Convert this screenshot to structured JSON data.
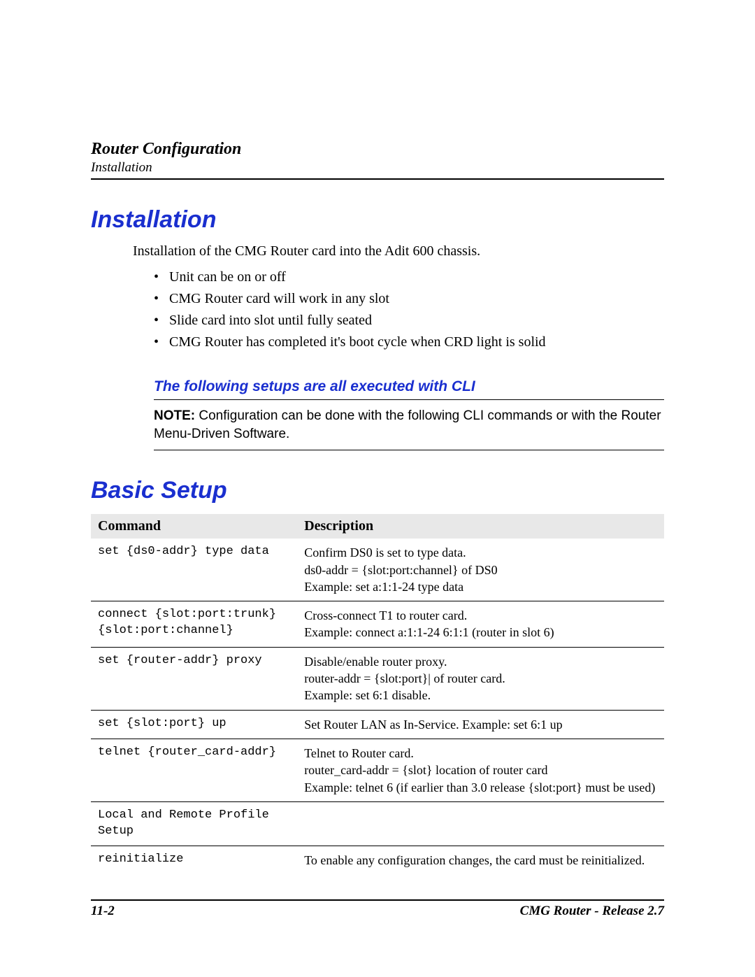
{
  "header": {
    "title": "Router Configuration",
    "subtitle": "Installation"
  },
  "sections": {
    "installation": {
      "heading": "Installation",
      "intro": "Installation of the CMG Router card into the Adit 600 chassis.",
      "bullets": [
        "Unit can be on or off",
        "CMG Router card will work in any slot",
        "Slide card into slot until fully seated",
        "CMG Router has completed it's boot cycle when CRD light is solid"
      ],
      "subheading": "The following setups are all executed with CLI",
      "note_label": "NOTE:",
      "note_text": "Configuration can be done with the following CLI commands or with the Router Menu-Driven Software."
    },
    "basic_setup": {
      "heading": "Basic Setup",
      "columns": {
        "command": "Command",
        "description": "Description"
      },
      "rows": [
        {
          "command": "set {ds0-addr} type data",
          "description": "Confirm DS0 is set to type data.\nds0-addr = {slot:port:channel} of DS0\nExample: set a:1:1-24 type data"
        },
        {
          "command": "connect {slot:port:trunk} {slot:port:channel}",
          "description": "Cross-connect T1 to router card.\nExample: connect a:1:1-24 6:1:1 (router in slot 6)"
        },
        {
          "command": "set {router-addr} proxy",
          "description": "Disable/enable router proxy.\nrouter-addr = {slot:port}| of router card.\nExample: set 6:1 disable."
        },
        {
          "command": "set {slot:port} up",
          "description": "Set Router LAN as In-Service.    Example: set 6:1 up"
        },
        {
          "command": "telnet {router_card-addr}",
          "description": "Telnet to Router card.\nrouter_card-addr = {slot} location of router card\nExample: telnet 6 (if earlier than 3.0 release {slot:port} must be used)"
        },
        {
          "command": "Local and Remote Profile Setup",
          "description": ""
        },
        {
          "command": "reinitialize",
          "description": "To enable any configuration changes, the card must be reinitialized."
        }
      ]
    }
  },
  "footer": {
    "page": "11-2",
    "product": "CMG Router - Release 2.7"
  }
}
